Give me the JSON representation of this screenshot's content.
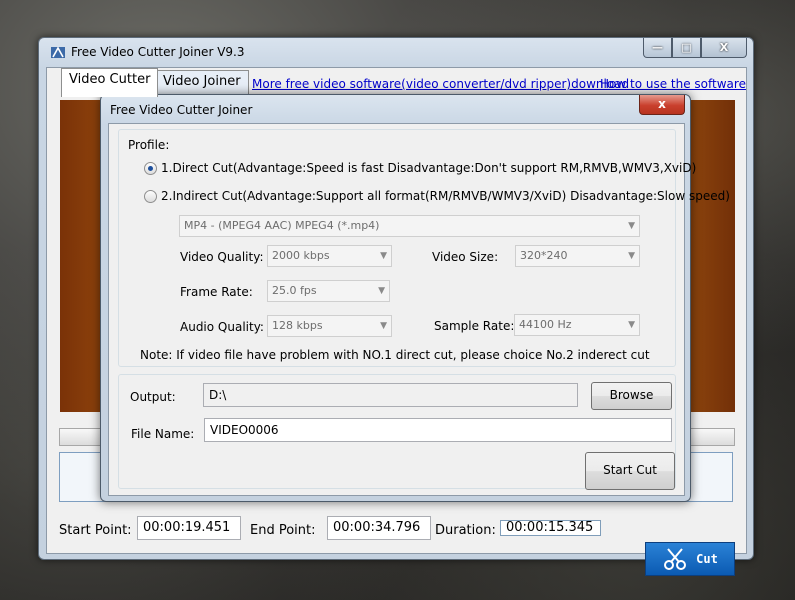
{
  "main_window": {
    "title": "Free Video Cutter Joiner V9.3",
    "controls": {
      "minimize": "—",
      "maximize": "□",
      "close": "X"
    },
    "tabs": [
      "Video Cutter",
      "Video Joiner"
    ],
    "links": [
      "More free video software(video converter/dvd ripper)download",
      "How to use the software"
    ],
    "start_point_label": "Start Point:",
    "start_point_value": "00:00:19.451",
    "end_point_label": "End Point:",
    "end_point_value": "00:00:34.796",
    "duration_label": "Duration:",
    "duration_value": "00:00:15.345",
    "cut_label": "Cut"
  },
  "dialog": {
    "title": "Free Video Cutter Joiner",
    "close": "x",
    "profile_label": "Profile:",
    "option1": "1.Direct Cut(Advantage:Speed is fast      Disadvantage:Don't support RM,RMVB,WMV3,XviD)",
    "option2": "2.Indirect Cut(Advantage:Support all format(RM/RMVB/WMV3/XviD) Disadvantage:Slow speed)",
    "selected_option": 1,
    "format_value": "MP4 - (MPEG4 AAC) MPEG4 (*.mp4)",
    "video_quality_label": "Video Quality:",
    "video_quality_value": "2000 kbps",
    "video_size_label": "Video Size:",
    "video_size_value": "320*240",
    "frame_rate_label": "Frame Rate:",
    "frame_rate_value": "25.0 fps",
    "audio_quality_label": "Audio Quality:",
    "audio_quality_value": "128 kbps",
    "sample_rate_label": "Sample Rate:",
    "sample_rate_value": "44100 Hz",
    "note": "Note: If video file have problem with NO.1 direct cut, please choice No.2 inderect cut",
    "output_label": "Output:",
    "output_value": "D:\\",
    "browse_label": "Browse",
    "filename_label": "File Name:",
    "filename_value": "VIDEO0006",
    "start_cut_label": "Start Cut"
  }
}
